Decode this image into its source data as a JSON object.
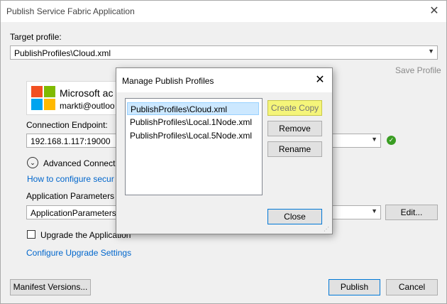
{
  "window": {
    "title": "Publish Service Fabric Application",
    "close_glyph": "✕"
  },
  "target_profile": {
    "label": "Target profile:",
    "value": "PublishProfiles\\Cloud.xml",
    "save_profile": "Save Profile"
  },
  "account": {
    "name_partial": "Microsoft ac",
    "email_partial": "markti@outloo"
  },
  "connection": {
    "label": "Connection Endpoint:",
    "value": "192.168.1.117:19000",
    "status_icon": "check-circle-icon"
  },
  "advanced": {
    "label": "Advanced Connect",
    "link": "How to configure secur"
  },
  "app_params": {
    "label": "Application Parameters",
    "value": "ApplicationParameters",
    "edit_label": "Edit..."
  },
  "upgrade": {
    "checkbox_label": "Upgrade the Application",
    "link": "Configure Upgrade Settings"
  },
  "footer": {
    "manifest": "Manifest Versions...",
    "publish": "Publish",
    "cancel": "Cancel"
  },
  "dialog": {
    "title": "Manage Publish Profiles",
    "profiles": [
      "PublishProfiles\\Cloud.xml",
      "PublishProfiles\\Local.1Node.xml",
      "PublishProfiles\\Local.5Node.xml"
    ],
    "selected_index": 0,
    "create_copy": "Create Copy",
    "remove": "Remove",
    "rename": "Rename",
    "close": "Close"
  },
  "colors": {
    "accent": "#0078d7",
    "link": "#0066cc",
    "highlight_button": "#f5f57a",
    "selection": "#cce8ff"
  }
}
